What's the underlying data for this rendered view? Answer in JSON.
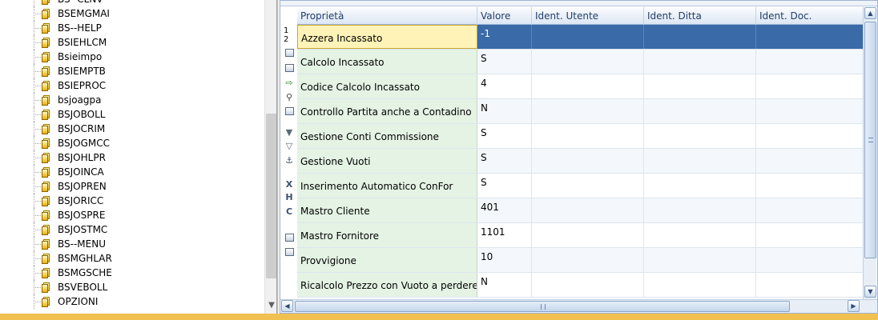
{
  "tree": {
    "items": [
      "BS--CLNV",
      "BSEMGMAI",
      "BS--HELP",
      "BSIEHLCM",
      "Bsieimpo",
      "BSIEMPTB",
      "BSIEPROC",
      "bsjoagpa",
      "BSJOBOLL",
      "BSJOCRIM",
      "BSJOGMCC",
      "BSJOHLPR",
      "BSJOINCA",
      "BSJOPREN",
      "BSJORICC",
      "BSJOSPRE",
      "BSJOSTMC",
      "BS--MENU",
      "BSMGHLAR",
      "BSMGSCHE",
      "BSVEBOLL",
      "OPZIONI"
    ]
  },
  "toolbar": {
    "row_numbers": [
      "1",
      "2"
    ],
    "icons": [
      "column-chooser-icon",
      "list-icon",
      "export-icon",
      "search-icon",
      "grid-icon",
      "filter-icon",
      "clear-filter-icon",
      "anchor-icon",
      "delete-column-icon",
      "hide-column-icon",
      "column-config-icon",
      "monitor-icon",
      "print-icon"
    ]
  },
  "grid": {
    "columns": [
      "Proprietà",
      "Valore",
      "Ident. Utente",
      "Ident. Ditta",
      "Ident. Doc."
    ],
    "rows": [
      {
        "property": "Azzera Incassato",
        "value": "-1"
      },
      {
        "property": "Calcolo Incassato",
        "value": "S"
      },
      {
        "property": "Codice Calcolo Incassato",
        "value": "4"
      },
      {
        "property": "Controllo Partita anche a Contadino",
        "value": "N"
      },
      {
        "property": "Gestione Conti Commissione",
        "value": "S"
      },
      {
        "property": "Gestione Vuoti",
        "value": "S"
      },
      {
        "property": "Inserimento Automatico ConFor",
        "value": "S"
      },
      {
        "property": "Mastro Cliente",
        "value": "401"
      },
      {
        "property": "Mastro Fornitore",
        "value": "1101"
      },
      {
        "property": "Provvigione",
        "value": "10"
      },
      {
        "property": "Ricalcolo Prezzo con Vuoto a perdere",
        "value": "N"
      }
    ],
    "selected_row": 0
  },
  "colors": {
    "selected_row": "#3a6aa8",
    "property_cell": "#e4f3e4",
    "header_text": "#1f3d6b",
    "frame": "#f0c050"
  }
}
